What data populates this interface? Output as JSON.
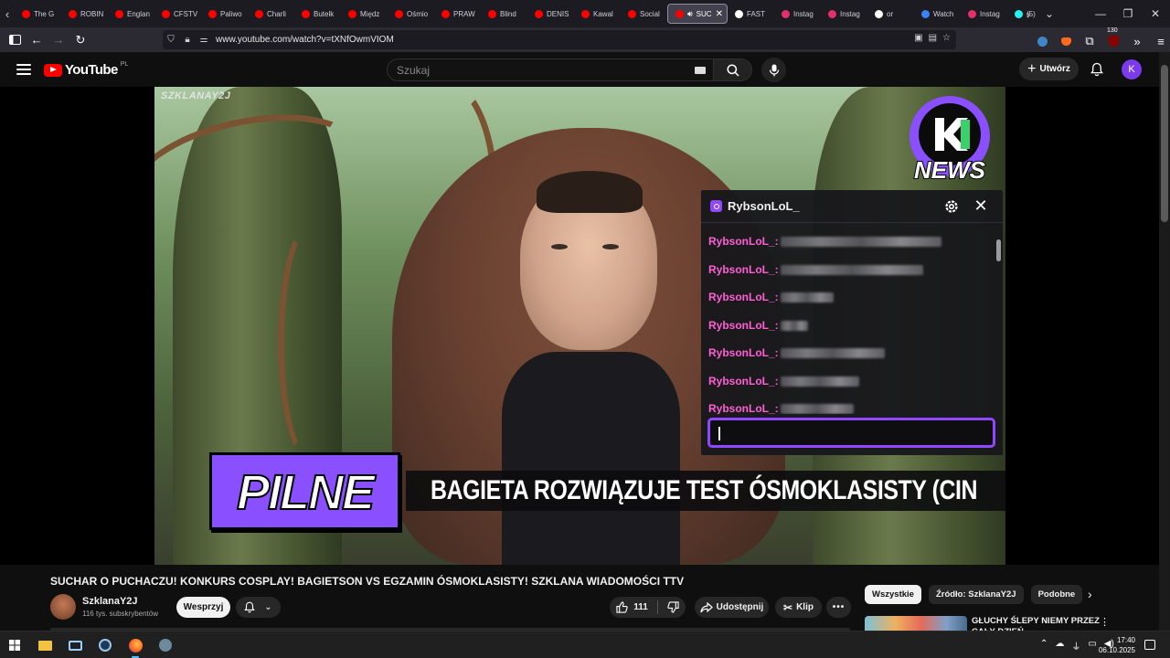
{
  "browser": {
    "tabs": [
      {
        "label": "The G",
        "favicon_color": "#ff0000"
      },
      {
        "label": "ROBIN",
        "favicon_color": "#ff0000"
      },
      {
        "label": "Englan",
        "favicon_color": "#ff0000"
      },
      {
        "label": "CFSTV",
        "favicon_color": "#ff0000"
      },
      {
        "label": "Paliwo",
        "favicon_color": "#ff0000"
      },
      {
        "label": "Charli",
        "favicon_color": "#ff0000"
      },
      {
        "label": "Butelk",
        "favicon_color": "#ff0000"
      },
      {
        "label": "Międz",
        "favicon_color": "#ff0000"
      },
      {
        "label": "Ośmio",
        "favicon_color": "#ff0000"
      },
      {
        "label": "PRAW",
        "favicon_color": "#ff0000"
      },
      {
        "label": "Blind",
        "favicon_color": "#ff0000"
      },
      {
        "label": "DENIS",
        "favicon_color": "#ff0000"
      },
      {
        "label": "Kawal",
        "favicon_color": "#ff0000"
      },
      {
        "label": "Social",
        "favicon_color": "#ff0000"
      },
      {
        "label": "SUC",
        "favicon_color": "#ff0000",
        "active": true
      },
      {
        "label": "FAST",
        "favicon_color": "#ffffff"
      },
      {
        "label": "Instag",
        "favicon_color": "#e1306c"
      },
      {
        "label": "Instag",
        "favicon_color": "#e1306c"
      },
      {
        "label": "or",
        "favicon_color": "#ffffff"
      },
      {
        "label": "Watch",
        "favicon_color": "#3b82f6"
      },
      {
        "label": "Instag",
        "favicon_color": "#e1306c"
      },
      {
        "label": "(5)",
        "favicon_color": "#25f4ee"
      }
    ],
    "url": "www.youtube.com/watch?v=tXNfOwmVIOM",
    "badge_count": "130"
  },
  "youtube": {
    "logo_text": "YouTube",
    "region": "PL",
    "search_placeholder": "Szukaj",
    "create_label": "Utwórz",
    "avatar_letter": "K"
  },
  "video": {
    "watermark": "SZKLANAY2J",
    "news_logo_text": "NEWS",
    "banner_label": "PILNE",
    "ticker_text": "BAGIETA ROZWIĄZUJE TEST ÓSMOKLASISTY (CIN"
  },
  "chat": {
    "channel": "RybsonLoL_",
    "messages": [
      {
        "user": "RybsonLoL_:"
      },
      {
        "user": "RybsonLoL_:"
      },
      {
        "user": "RybsonLoL_:"
      },
      {
        "user": "RybsonLoL_:"
      },
      {
        "user": "RybsonLoL_:"
      },
      {
        "user": "RybsonLoL_:"
      },
      {
        "user": "RybsonLoL_:"
      }
    ]
  },
  "details": {
    "title": "SUCHAR O PUCHACZU! KONKURS COSPLAY! BAGIETSON VS EGZAMIN ÓSMOKLASISTY! SZKLANA WIADOMOŚCI TTV",
    "channel_name": "SzklanaY2J",
    "subscribers": "116 tys. subskrybentów",
    "support_label": "Wesprzyj",
    "likes": "111",
    "share_label": "Udostępnij",
    "clip_label": "Klip"
  },
  "sidebar": {
    "chips": [
      "Wszystkie",
      "Źródło: SzklanaY2J",
      "Podobne"
    ],
    "next_title": "GŁUCHY ŚLEPY NIEMY PRZEZ CAŁY DZIEŃ"
  },
  "taskbar": {
    "time": "17:40",
    "date": "06.10.2025"
  }
}
